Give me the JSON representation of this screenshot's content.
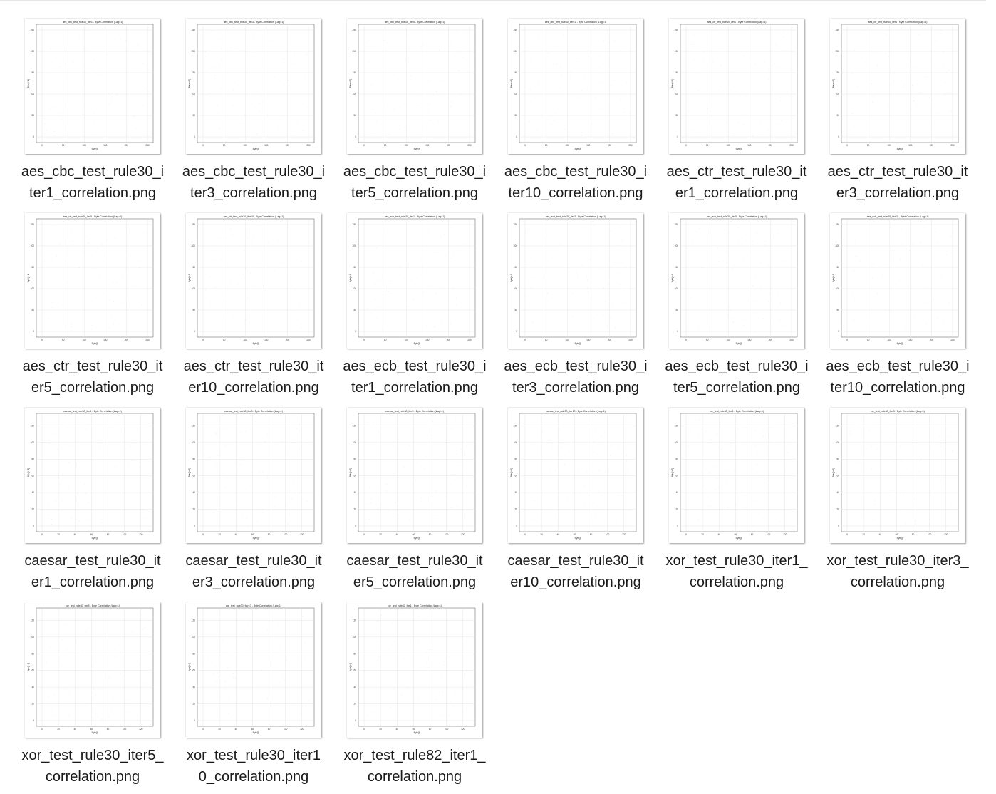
{
  "view": {
    "files": [
      {
        "name": "aes_cbc_test_rule30_iter1_correlation.png",
        "line1": "aes_cbc_test_rule30_i",
        "line2": "ter1_correlation.png",
        "thumb_title": "aes_cbc_test_rule30_iter1 - Byte Correlation (Lag=1)",
        "scale": 250,
        "ticks": [
          "0",
          "50",
          "100",
          "150",
          "200",
          "250"
        ]
      },
      {
        "name": "aes_cbc_test_rule30_iter3_correlation.png",
        "line1": "aes_cbc_test_rule30_i",
        "line2": "ter3_correlation.png",
        "thumb_title": "aes_cbc_test_rule30_iter3 - Byte Correlation (Lag=1)",
        "scale": 250,
        "ticks": [
          "0",
          "50",
          "100",
          "150",
          "200",
          "250"
        ]
      },
      {
        "name": "aes_cbc_test_rule30_iter5_correlation.png",
        "line1": "aes_cbc_test_rule30_i",
        "line2": "ter5_correlation.png",
        "thumb_title": "aes_cbc_test_rule30_iter5 - Byte Correlation (Lag=1)",
        "scale": 250,
        "ticks": [
          "0",
          "50",
          "100",
          "150",
          "200",
          "250"
        ]
      },
      {
        "name": "aes_cbc_test_rule30_iter10_correlation.png",
        "line1": "aes_cbc_test_rule30_i",
        "line2": "ter10_correlation.png",
        "thumb_title": "aes_cbc_test_rule30_iter10 - Byte Correlation (Lag=1)",
        "scale": 250,
        "ticks": [
          "0",
          "50",
          "100",
          "150",
          "200",
          "250"
        ]
      },
      {
        "name": "aes_ctr_test_rule30_iter1_correlation.png",
        "line1": "aes_ctr_test_rule30_it",
        "line2": "er1_correlation.png",
        "thumb_title": "aes_ctr_test_rule30_iter1 - Byte Correlation (Lag=1)",
        "scale": 250,
        "ticks": [
          "0",
          "50",
          "100",
          "150",
          "200",
          "250"
        ]
      },
      {
        "name": "aes_ctr_test_rule30_iter3_correlation.png",
        "line1": "aes_ctr_test_rule30_it",
        "line2": "er3_correlation.png",
        "thumb_title": "aes_ctr_test_rule30_iter3 - Byte Correlation (Lag=1)",
        "scale": 250,
        "ticks": [
          "0",
          "50",
          "100",
          "150",
          "200",
          "250"
        ]
      },
      {
        "name": "aes_ctr_test_rule30_iter5_correlation.png",
        "line1": "aes_ctr_test_rule30_it",
        "line2": "er5_correlation.png",
        "thumb_title": "aes_ctr_test_rule30_iter5 - Byte Correlation (Lag=1)",
        "scale": 250,
        "ticks": [
          "0",
          "50",
          "100",
          "150",
          "200",
          "250"
        ]
      },
      {
        "name": "aes_ctr_test_rule30_iter10_correlation.png",
        "line1": "aes_ctr_test_rule30_it",
        "line2": "er10_correlation.png",
        "thumb_title": "aes_ctr_test_rule30_iter10 - Byte Correlation (Lag=1)",
        "scale": 250,
        "ticks": [
          "0",
          "50",
          "100",
          "150",
          "200",
          "250"
        ]
      },
      {
        "name": "aes_ecb_test_rule30_iter1_correlation.png",
        "line1": "aes_ecb_test_rule30_i",
        "line2": "ter1_correlation.png",
        "thumb_title": "aes_ecb_test_rule30_iter1 - Byte Correlation (Lag=1)",
        "scale": 250,
        "ticks": [
          "0",
          "50",
          "100",
          "150",
          "200",
          "250"
        ]
      },
      {
        "name": "aes_ecb_test_rule30_iter3_correlation.png",
        "line1": "aes_ecb_test_rule30_i",
        "line2": "ter3_correlation.png",
        "thumb_title": "aes_ecb_test_rule30_iter3 - Byte Correlation (Lag=1)",
        "scale": 250,
        "ticks": [
          "0",
          "50",
          "100",
          "150",
          "200",
          "250"
        ]
      },
      {
        "name": "aes_ecb_test_rule30_iter5_correlation.png",
        "line1": "aes_ecb_test_rule30_i",
        "line2": "ter5_correlation.png",
        "thumb_title": "aes_ecb_test_rule30_iter5 - Byte Correlation (Lag=1)",
        "scale": 250,
        "ticks": [
          "0",
          "50",
          "100",
          "150",
          "200",
          "250"
        ]
      },
      {
        "name": "aes_ecb_test_rule30_iter10_correlation.png",
        "line1": "aes_ecb_test_rule30_i",
        "line2": "ter10_correlation.png",
        "thumb_title": "aes_ecb_test_rule30_iter10 - Byte Correlation (Lag=1)",
        "scale": 250,
        "ticks": [
          "0",
          "50",
          "100",
          "150",
          "200",
          "250"
        ]
      },
      {
        "name": "caesar_test_rule30_iter1_correlation.png",
        "line1": "caesar_test_rule30_it",
        "line2": "er1_correlation.png",
        "thumb_title": "caesar_test_rule30_iter1 - Byte Correlation (Lag=1)",
        "scale": 128,
        "ticks": [
          "0",
          "20",
          "40",
          "60",
          "80",
          "100",
          "120"
        ]
      },
      {
        "name": "caesar_test_rule30_iter3_correlation.png",
        "line1": "caesar_test_rule30_it",
        "line2": "er3_correlation.png",
        "thumb_title": "caesar_test_rule30_iter3 - Byte Correlation (Lag=1)",
        "scale": 128,
        "ticks": [
          "0",
          "20",
          "40",
          "60",
          "80",
          "100",
          "120"
        ]
      },
      {
        "name": "caesar_test_rule30_iter5_correlation.png",
        "line1": "caesar_test_rule30_it",
        "line2": "er5_correlation.png",
        "thumb_title": "caesar_test_rule30_iter5 - Byte Correlation (Lag=1)",
        "scale": 128,
        "ticks": [
          "0",
          "20",
          "40",
          "60",
          "80",
          "100",
          "120"
        ]
      },
      {
        "name": "caesar_test_rule30_iter10_correlation.png",
        "line1": "caesar_test_rule30_it",
        "line2": "er10_correlation.png",
        "thumb_title": "caesar_test_rule30_iter10 - Byte Correlation (Lag=1)",
        "scale": 128,
        "ticks": [
          "0",
          "20",
          "40",
          "60",
          "80",
          "100",
          "120"
        ]
      },
      {
        "name": "xor_test_rule30_iter1_correlation.png",
        "line1": "xor_test_rule30_iter1_",
        "line2": "correlation.png",
        "thumb_title": "xor_test_rule30_iter1 - Byte Correlation (Lag=1)",
        "scale": 128,
        "ticks": [
          "0",
          "20",
          "40",
          "60",
          "80",
          "100",
          "120"
        ]
      },
      {
        "name": "xor_test_rule30_iter3_correlation.png",
        "line1": "xor_test_rule30_iter3_",
        "line2": "correlation.png",
        "thumb_title": "xor_test_rule30_iter3 - Byte Correlation (Lag=1)",
        "scale": 128,
        "ticks": [
          "0",
          "20",
          "40",
          "60",
          "80",
          "100",
          "120"
        ]
      },
      {
        "name": "xor_test_rule30_iter5_correlation.png",
        "line1": "xor_test_rule30_iter5_",
        "line2": "correlation.png",
        "thumb_title": "xor_test_rule30_iter5 - Byte Correlation (Lag=1)",
        "scale": 128,
        "ticks": [
          "0",
          "20",
          "40",
          "60",
          "80",
          "100",
          "120"
        ]
      },
      {
        "name": "xor_test_rule30_iter10_correlation.png",
        "line1": "xor_test_rule30_iter1",
        "line2": "0_correlation.png",
        "thumb_title": "xor_test_rule30_iter10 - Byte Correlation (Lag=1)",
        "scale": 128,
        "ticks": [
          "0",
          "20",
          "40",
          "60",
          "80",
          "100",
          "120"
        ]
      },
      {
        "name": "xor_test_rule82_iter1_correlation.png",
        "line1": "xor_test_rule82_iter1_",
        "line2": "correlation.png",
        "thumb_title": "xor_test_rule82_iter1 - Byte Correlation (Lag=1)",
        "scale": 128,
        "ticks": [
          "0",
          "20",
          "40",
          "60",
          "80",
          "100",
          "120"
        ]
      }
    ],
    "thumb_axis_labels": {
      "x": "Byte[i]",
      "y": "Byte[i+1]"
    }
  },
  "colors": {
    "text": "#1a1a1a",
    "thumb_axis": "#555555",
    "thumb_grid": "#e0e0e0",
    "thumb_point": "#3a6ea5"
  }
}
